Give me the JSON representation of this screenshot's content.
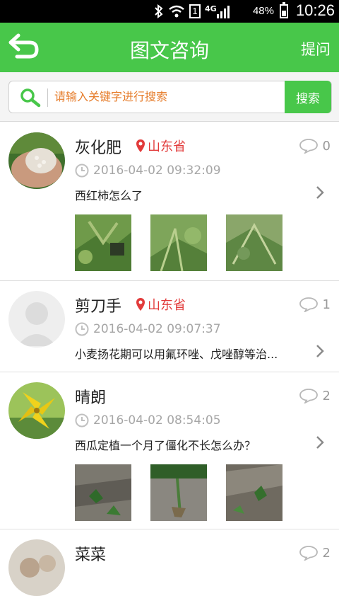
{
  "status_bar": {
    "network": "4G",
    "sim": "1",
    "battery": "48%",
    "time": "10:26"
  },
  "header": {
    "title": "图文咨询",
    "ask_label": "提问",
    "back_icon": "back-arrow-icon"
  },
  "search": {
    "placeholder": "请输入关键字进行搜索",
    "button_label": "搜索"
  },
  "posts": [
    {
      "name": "灰化肥",
      "location": "山东省",
      "time": "2016-04-02 09:32:09",
      "description": "西红柿怎么了",
      "comments": "0",
      "has_images": true
    },
    {
      "name": "剪刀手",
      "location": "山东省",
      "time": "2016-04-02 09:07:37",
      "description": "小麦扬花期可以用氟环唑、戊唑醇等治...",
      "comments": "1",
      "has_images": false
    },
    {
      "name": "晴朗",
      "location": "",
      "time": "2016-04-02 08:54:05",
      "description": "西瓜定植一个月了僵化不长怎么办？",
      "comments": "2",
      "has_images": true
    },
    {
      "name": "菜菜",
      "location": "",
      "time": "",
      "description": "",
      "comments": "2",
      "has_images": false
    }
  ],
  "colors": {
    "brand_green": "#48c74a",
    "location_red": "#e23b3b",
    "placeholder_orange": "#e67c2a"
  }
}
